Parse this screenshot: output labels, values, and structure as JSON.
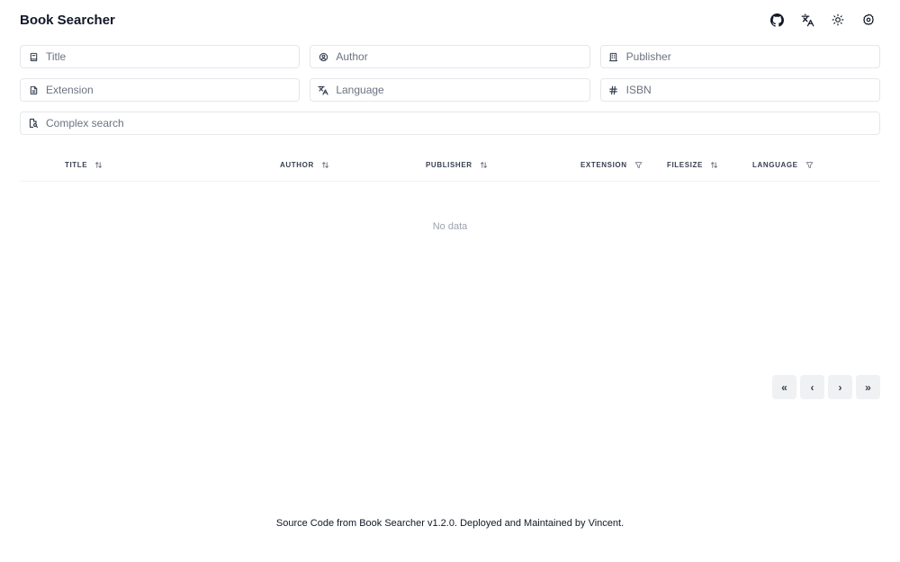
{
  "header": {
    "title": "Book Searcher",
    "actions": [
      {
        "name": "github-icon"
      },
      {
        "name": "translate-icon"
      },
      {
        "name": "sun-icon"
      },
      {
        "name": "settings-icon"
      }
    ]
  },
  "search": {
    "title_placeholder": "Title",
    "author_placeholder": "Author",
    "publisher_placeholder": "Publisher",
    "extension_placeholder": "Extension",
    "language_placeholder": "Language",
    "isbn_placeholder": "ISBN",
    "complex_placeholder": "Complex search"
  },
  "table": {
    "columns": [
      {
        "label": "TITLE",
        "control": "sort-icon"
      },
      {
        "label": "AUTHOR",
        "control": "sort-icon"
      },
      {
        "label": "PUBLISHER",
        "control": "sort-icon"
      },
      {
        "label": "EXTENSION",
        "control": "filter-icon"
      },
      {
        "label": "FILESIZE",
        "control": "sort-icon"
      },
      {
        "label": "LANGUAGE",
        "control": "filter-icon"
      }
    ],
    "empty_text": "No data"
  },
  "pagination": {
    "first": "«",
    "prev": "‹",
    "next": "›",
    "last": "»"
  },
  "footer": {
    "text": "Source Code from Book Searcher v1.2.0. Deployed and Maintained by Vincent."
  }
}
